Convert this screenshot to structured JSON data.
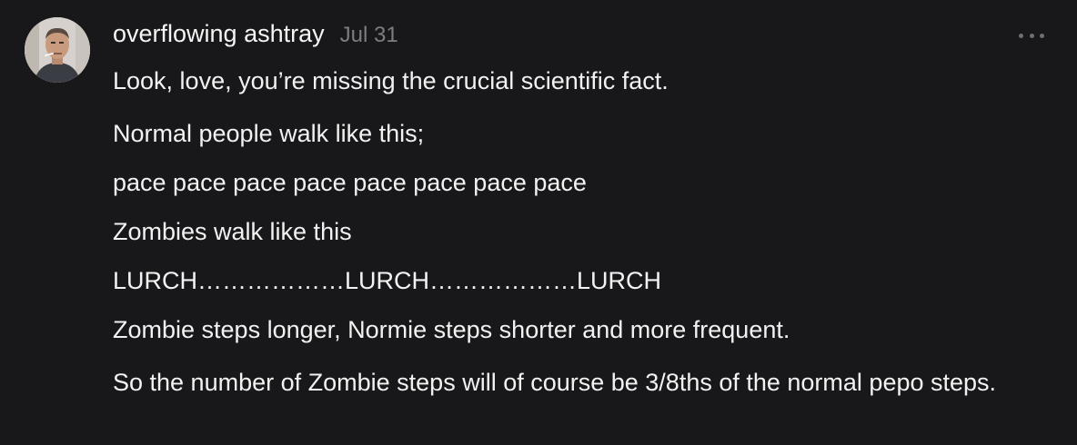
{
  "comment": {
    "author": "overflowing ashtray",
    "timestamp": "Jul 31",
    "avatar_icon": "avatar-photo",
    "more_icon": "more-options-icon",
    "paragraphs": [
      "Look, love, you’re missing the crucial scientific fact.",
      "Normal people walk like this;",
      "pace pace pace pace pace pace pace pace",
      "Zombies walk like this",
      "LURCH………………LURCH………………LURCH",
      "Zombie steps longer, Normie steps shorter and more frequent.",
      "So the number of Zombie steps will of course be 3/8ths of the normal pepo steps."
    ]
  },
  "colors": {
    "background": "#18181a",
    "text": "#f2f2f2",
    "muted": "#7d7d82"
  }
}
